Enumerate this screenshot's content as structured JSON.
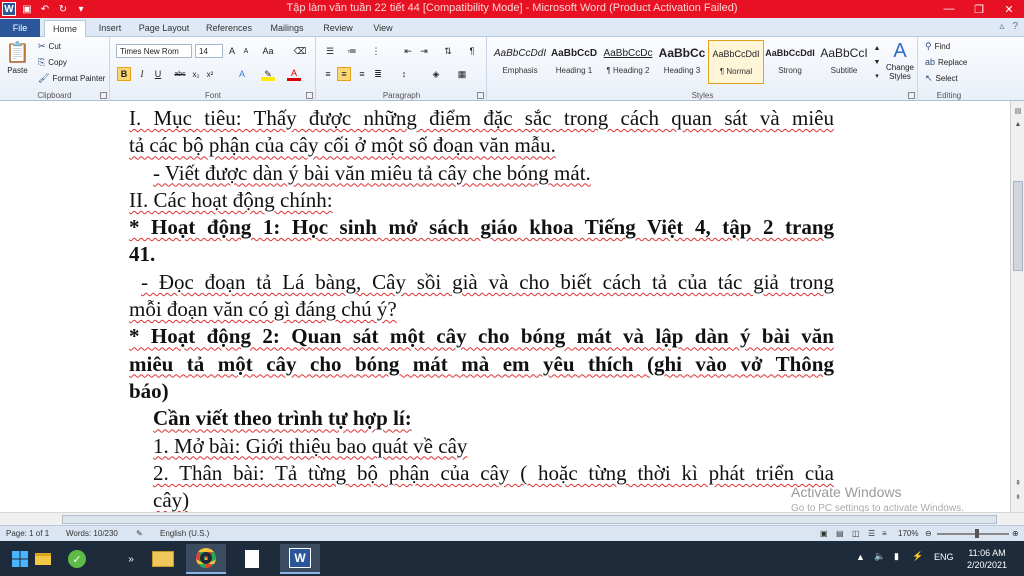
{
  "window": {
    "title": "Tập làm văn tuần 22 tiết 44 [Compatibility Mode] - Microsoft Word (Product Activation Failed)",
    "brand_color": "#2b579a",
    "titlebar_color": "#e81123"
  },
  "tabs": [
    "File",
    "Home",
    "Insert",
    "Page Layout",
    "References",
    "Mailings",
    "Review",
    "View"
  ],
  "active_tab": "Home",
  "ribbon": {
    "clipboard": {
      "paste": "Paste",
      "cut": "Cut",
      "copy": "Copy",
      "format_painter": "Format Painter",
      "label": "Clipboard"
    },
    "font": {
      "name": "Times New Rom",
      "size": "14",
      "label": "Font"
    },
    "paragraph": {
      "label": "Paragraph"
    },
    "styles": {
      "items": [
        {
          "preview": "AaBbCcDdI",
          "name": "Emphasis"
        },
        {
          "preview": "AaBbCcD",
          "name": "Heading 1"
        },
        {
          "preview": "AaBbCcDc",
          "name": "¶ Heading 2"
        },
        {
          "preview": "AaBbCc",
          "name": "Heading 3"
        },
        {
          "preview": "AaBbCcDdI",
          "name": "¶ Normal"
        },
        {
          "preview": "AaBbCcDdI",
          "name": "Strong"
        },
        {
          "preview": "AaBbCcI",
          "name": "Subtitle"
        }
      ],
      "change_styles": "Change Styles",
      "label": "Styles"
    },
    "editing": {
      "find": "Find",
      "replace": "Replace",
      "select": "Select",
      "label": "Editing"
    }
  },
  "document": {
    "lines": [
      "I. Mục tiêu: Thấy được những điểm đặc sắc trong cách quan sát và miêu",
      "tả các bộ phận của cây cối ở một số đoạn văn mẫu.",
      "- Viết được dàn ý bài văn miêu tả cây che bóng mát.",
      "II. Các hoạt động chính:",
      "* Hoạt động 1: Học sinh mở sách giáo khoa Tiếng Việt 4, tập 2 trang",
      "41.",
      "- Đọc đoạn tả Lá bàng, Cây sồi già và cho biết cách tả của tác giả trong",
      "mỗi đoạn văn có gì đáng chú ý?",
      "* Hoạt động 2: Quan sát một cây cho bóng mát và lập dàn ý bài văn",
      "miêu tả một cây cho bóng mát mà em yêu thích (ghi vào vở Thông",
      "báo)",
      "Cần viết theo trình tự hợp lí:",
      "1. Mở bài: Giới thiệu bao quát về cây",
      "2. Thân bài: Tả từng bộ phận của cây ( hoặc từng thời kì phát triển của",
      "cây)"
    ]
  },
  "watermark": {
    "title": "Activate Windows",
    "subtitle": "Go to PC settings to activate Windows."
  },
  "status": {
    "page": "Page: 1 of 1",
    "words": "Words: 10/230",
    "language": "English (U.S.)",
    "zoom": "170%"
  },
  "taskbar": {
    "lang": "ENG",
    "time": "11:06 AM",
    "date": "2/20/2021"
  }
}
